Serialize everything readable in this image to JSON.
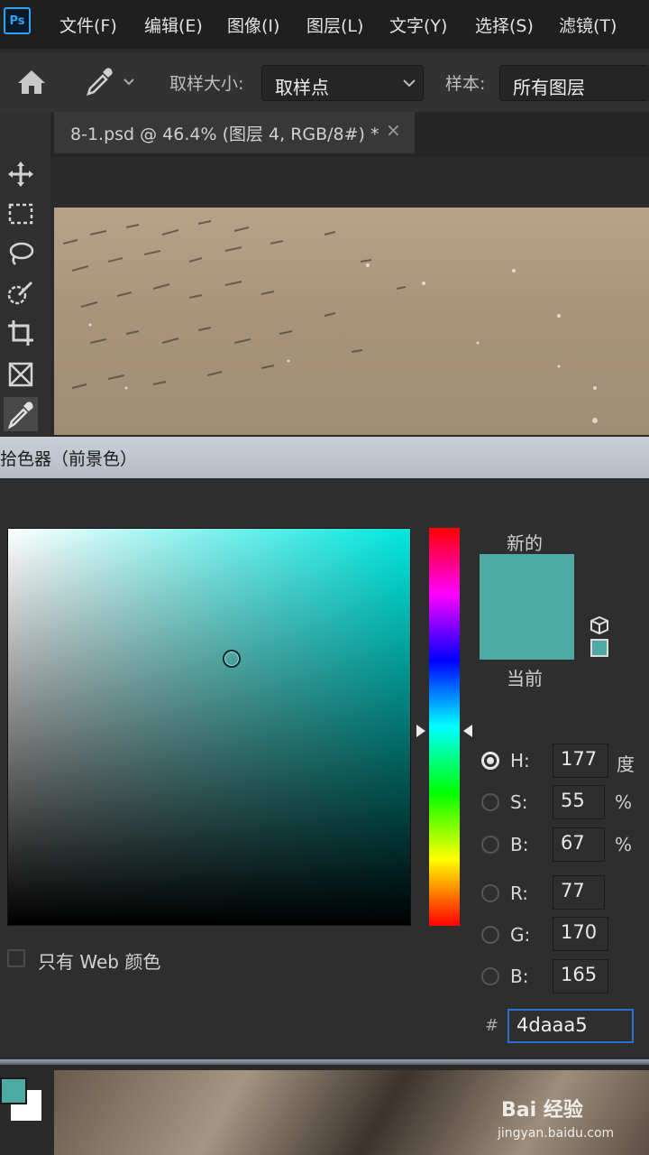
{
  "menubar": {
    "logo": "Ps",
    "items": [
      "文件(F)",
      "编辑(E)",
      "图像(I)",
      "图层(L)",
      "文字(Y)",
      "选择(S)",
      "滤镜(T)"
    ]
  },
  "options": {
    "sample_size_label": "取样大小:",
    "sample_size_value": "取样点",
    "sample_label": "样本:",
    "sample_value": "所有图层"
  },
  "document_tab": {
    "title": "8-1.psd @ 46.4% (图层 4, RGB/8#) *",
    "close": "×"
  },
  "tools": [
    "move-tool",
    "marquee-tool",
    "lasso-tool",
    "quick-selection-tool",
    "crop-tool",
    "frame-tool",
    "eyedropper-tool"
  ],
  "dialog": {
    "title": "拾色器（前景色）",
    "new_label": "新的",
    "current_label": "当前",
    "new_color": "#4daaa5",
    "current_color": "#4daaa5",
    "hue_base_color": "#00e6df",
    "fields": {
      "H": {
        "label": "H:",
        "value": "177",
        "unit": "度"
      },
      "S": {
        "label": "S:",
        "value": "55",
        "unit": "%"
      },
      "Bv": {
        "label": "B:",
        "value": "67",
        "unit": "%"
      },
      "R": {
        "label": "R:",
        "value": "77"
      },
      "G": {
        "label": "G:",
        "value": "170"
      },
      "Bc": {
        "label": "B:",
        "value": "165"
      },
      "hex_label": "#",
      "hex_value": "4daaa5"
    },
    "web_only_label": "只有 Web 颜色"
  },
  "watermark": {
    "brand": "Bai  经验",
    "url": "jingyan.baidu.com"
  }
}
